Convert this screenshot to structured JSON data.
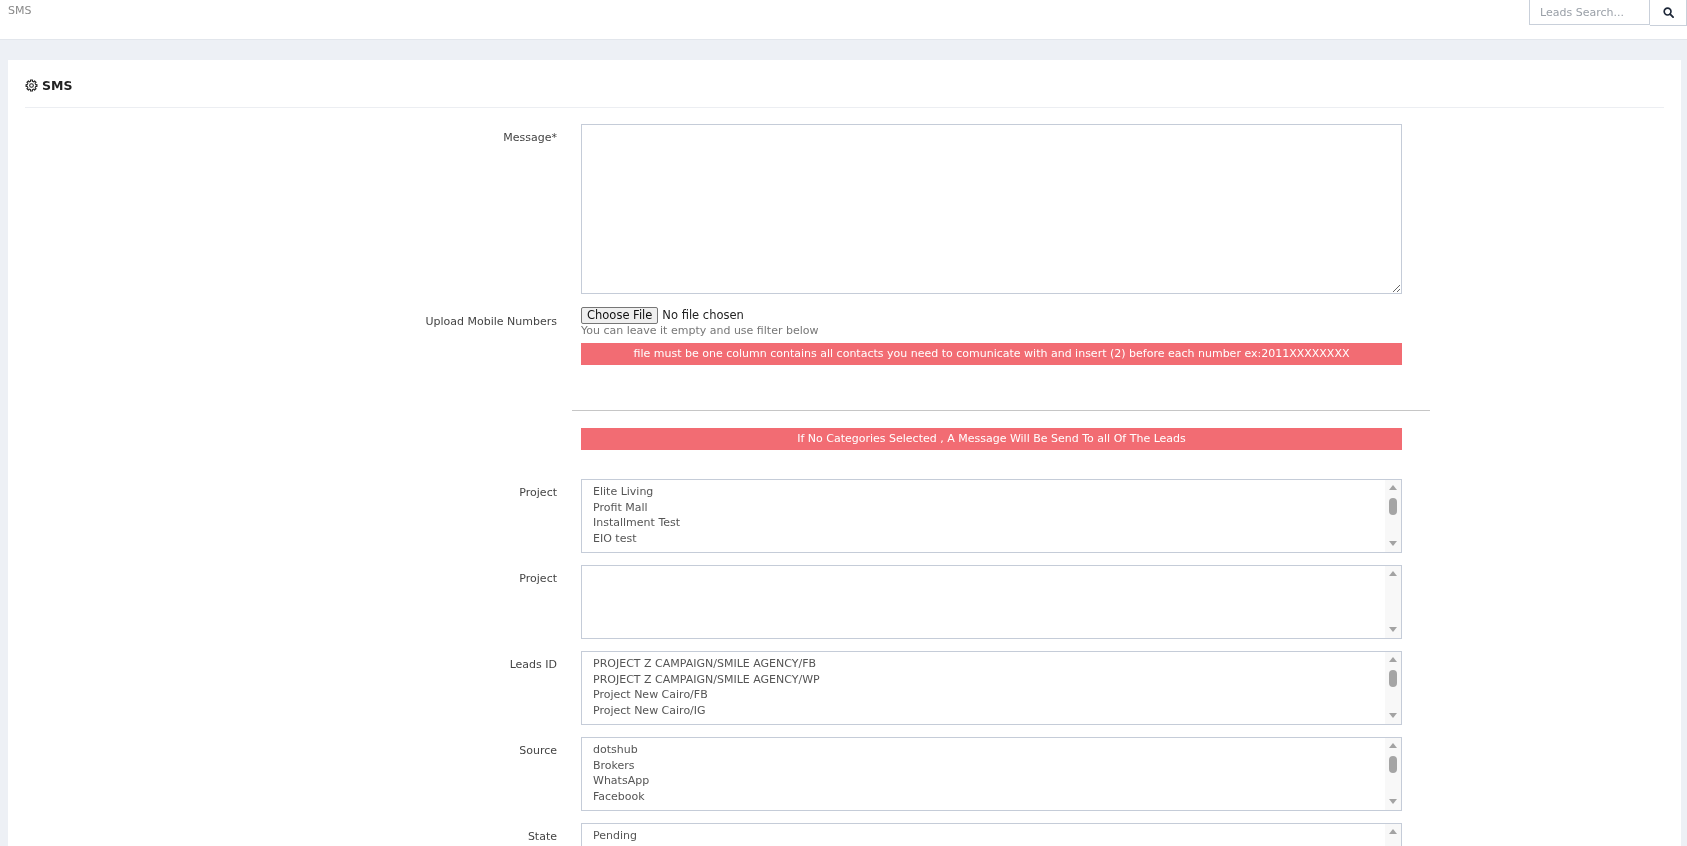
{
  "top_bar": {
    "title": "SMS",
    "search": {
      "placeholder": "Leads Search..."
    }
  },
  "card": {
    "title": "SMS"
  },
  "message": {
    "label": "Message*"
  },
  "upload": {
    "label": "Upload Mobile Numbers",
    "button": "Choose File",
    "file_status": "No file chosen",
    "hint": "You can leave it empty and use filter below",
    "alert": "file must be one column contains all contacts you need to comunicate with and insert (2) before each number ex:2011XXXXXXXX"
  },
  "filter_alert": "If No Categories Selected , A Message Will Be Send To all Of The Leads",
  "filters": [
    {
      "label": "Project",
      "options": [
        "Elite Living",
        "Profit Mall",
        "Installment Test",
        "EIO test"
      ]
    },
    {
      "label": "Project"
    },
    {
      "label": "Leads ID",
      "options": [
        "PROJECT Z CAMPAIGN/SMILE AGENCY/FB",
        "PROJECT Z CAMPAIGN/SMILE AGENCY/WP",
        "Project New Cairo/FB",
        "Project New Cairo/IG"
      ]
    },
    {
      "label": "Source",
      "options": [
        "dotshub",
        "Brokers",
        "WhatsApp",
        "Facebook"
      ]
    },
    {
      "label": "State",
      "options": [
        "Pending"
      ]
    }
  ]
}
